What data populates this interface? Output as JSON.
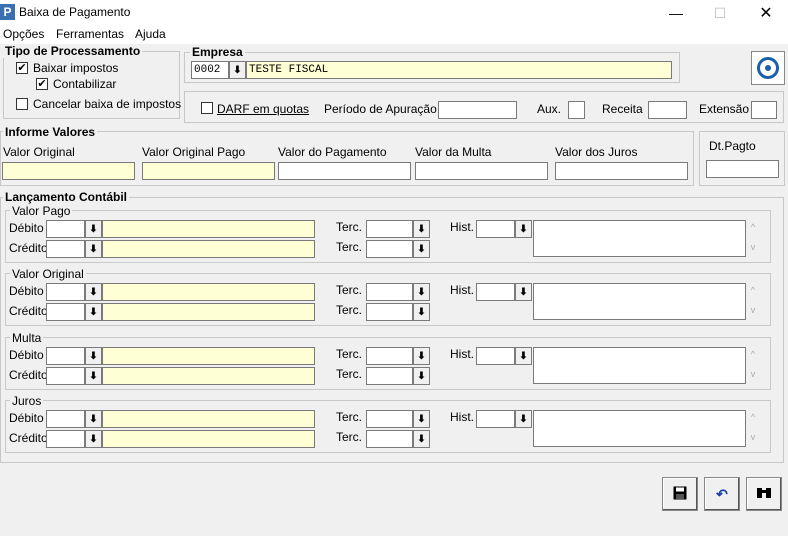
{
  "window": {
    "app_icon": "P",
    "title": "Baixa de Pagamento",
    "minimize_glyph": "—",
    "maximize_glyph": "☐",
    "close_glyph": "✕"
  },
  "menu": [
    "Opções",
    "Ferramentas",
    "Ajuda"
  ],
  "tipo": {
    "title": "Tipo de Processamento",
    "baixar": "Baixar impostos",
    "baixar_checked": true,
    "contabilizar": "Contabilizar",
    "contabilizar_checked": true,
    "cancelar": "Cancelar baixa de impostos",
    "cancelar_checked": false
  },
  "empresa": {
    "title": "Empresa",
    "code": "0002",
    "name": "TESTE FISCAL"
  },
  "darf": {
    "label": "DARF em quotas",
    "checked": false,
    "periodo": "Período de Apuração",
    "aux": "Aux.",
    "receita": "Receita",
    "extensao": "Extensão"
  },
  "valores": {
    "title": "Informe Valores",
    "original": "Valor Original",
    "original_pago": "Valor Original Pago",
    "pagamento": "Valor do Pagamento",
    "multa": "Valor da Multa",
    "juros": "Valor dos Juros",
    "dt_pagto": "Dt.Pagto"
  },
  "lanc": {
    "title": "Lançamento Contábil",
    "debito": "Débito",
    "credito": "Crédito",
    "terc": "Terc.",
    "hist": "Hist.",
    "groups": [
      "Valor Pago",
      "Valor Original",
      "Multa",
      "Juros"
    ]
  },
  "icons": {
    "save": "floppy-icon",
    "undo": "undo-icon",
    "search": "binoculars-icon"
  }
}
